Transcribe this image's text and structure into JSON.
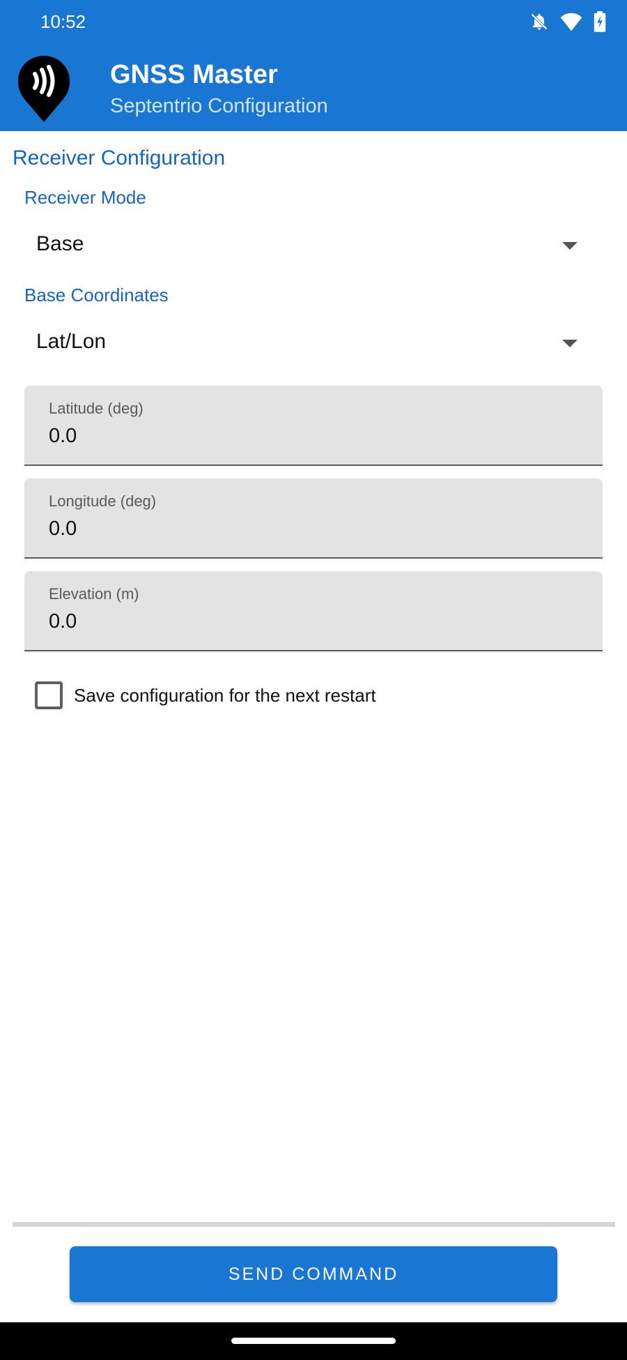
{
  "status_bar": {
    "time": "10:52",
    "icons": [
      "bell-off-icon",
      "wifi-icon",
      "battery-charging-icon"
    ]
  },
  "app_bar": {
    "title": "GNSS Master",
    "subtitle": "Septentrio Configuration",
    "logo_icon": "gnss-pin-logo-icon"
  },
  "form": {
    "section_title": "Receiver Configuration",
    "receiver_mode": {
      "label": "Receiver Mode",
      "value": "Base"
    },
    "base_coordinates": {
      "label": "Base Coordinates",
      "value": "Lat/Lon"
    },
    "latitude": {
      "label": "Latitude (deg)",
      "value": "0.0"
    },
    "longitude": {
      "label": "Longitude (deg)",
      "value": "0.0"
    },
    "elevation": {
      "label": "Elevation (m)",
      "value": "0.0"
    },
    "save_checkbox": {
      "label": "Save configuration for the next restart",
      "checked": false
    }
  },
  "actions": {
    "send_label": "SEND COMMAND"
  },
  "colors": {
    "primary": "#1976d2",
    "accent_text": "#1565c0",
    "field_bg": "#e3e3e3"
  }
}
